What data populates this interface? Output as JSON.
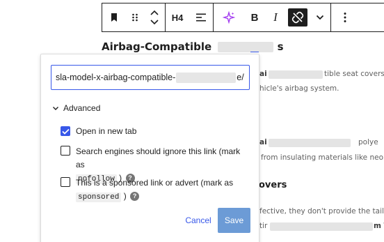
{
  "toolbar": {
    "heading_level_label": "H4",
    "bold_label": "B",
    "italic_label": "I"
  },
  "editor": {
    "heading_text": "Airbag-Compatible",
    "heading_link_fragment": "s",
    "bg_lines": [
      "ai",
      "tible seat covers. I",
      "hicle's airbag system.",
      "ai",
      "polye",
      "from insulating materials like neo",
      "fective, they don't provide the tailo",
      "tir",
      "m T"
    ],
    "heading_2_text": "overs"
  },
  "link_popover": {
    "url_value_prefix": "sla-model-x-airbag-compatible-",
    "url_value_suffix": "e/",
    "advanced_label": "Advanced",
    "options": [
      {
        "label": "Open in new tab",
        "checked": true
      },
      {
        "label": "Search engines should ignore this link (mark as",
        "code": "nofollow",
        "after": ")",
        "checked": false
      },
      {
        "label": "This is a sponsored link or advert (mark as",
        "code": "sponsored",
        "after": ")",
        "checked": false
      }
    ],
    "cancel_label": "Cancel",
    "save_label": "Save"
  },
  "colors": {
    "accent": "#3858e9",
    "save_disabled": "#6c9bd6",
    "ai_icon": "#a33df0",
    "text": "#1e1e1e"
  },
  "icons": {
    "bookmark": "bookmark-icon",
    "drag": "drag-handle-icon",
    "move": "move-up-down-icon",
    "align": "align-left-icon",
    "ai": "sparkle-ai-icon",
    "unlink": "unlink-icon",
    "more_format": "chevron-down-icon",
    "options": "more-vertical-icon",
    "advanced": "chevron-down-icon",
    "help": "help-icon"
  }
}
